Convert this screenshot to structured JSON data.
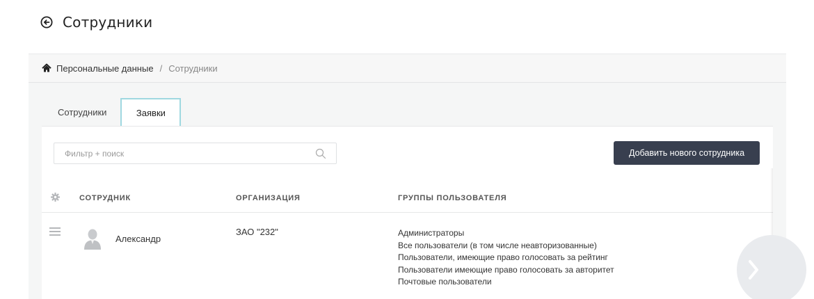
{
  "header": {
    "title": "Сотрудники"
  },
  "breadcrumb": {
    "home": "Персональные данные",
    "separator": "/",
    "current": "Сотрудники"
  },
  "tabs": [
    {
      "label": "Сотрудники",
      "active": false
    },
    {
      "label": "Заявки",
      "active": true
    }
  ],
  "search": {
    "placeholder": "Фильтр + поиск",
    "value": ""
  },
  "toolbar": {
    "add_label": "Добавить нового сотрудника"
  },
  "table": {
    "columns": [
      "СОТРУДНИК",
      "ОРГАНИЗАЦИЯ",
      "ГРУППЫ ПОЛЬЗОВАТЕЛЯ"
    ],
    "rows": [
      {
        "name": "Александр",
        "organization": "ЗАО \"232\"",
        "groups": [
          "Администраторы",
          "Все пользователи (в том числе неавторизованные)",
          "Пользователи, имеющие право голосовать за рейтинг",
          "Пользователи имеющие право голосовать за авторитет",
          "Почтовые пользователи"
        ]
      }
    ]
  },
  "colors": {
    "button": "#383f4f",
    "tab_border": "#9fd8e0",
    "panel": "#f5f6f6"
  },
  "icons": [
    "back-arrow-icon",
    "home-icon",
    "search-icon",
    "gear-icon",
    "drag-handle-icon",
    "user-avatar-icon",
    "chevron-right-icon"
  ]
}
